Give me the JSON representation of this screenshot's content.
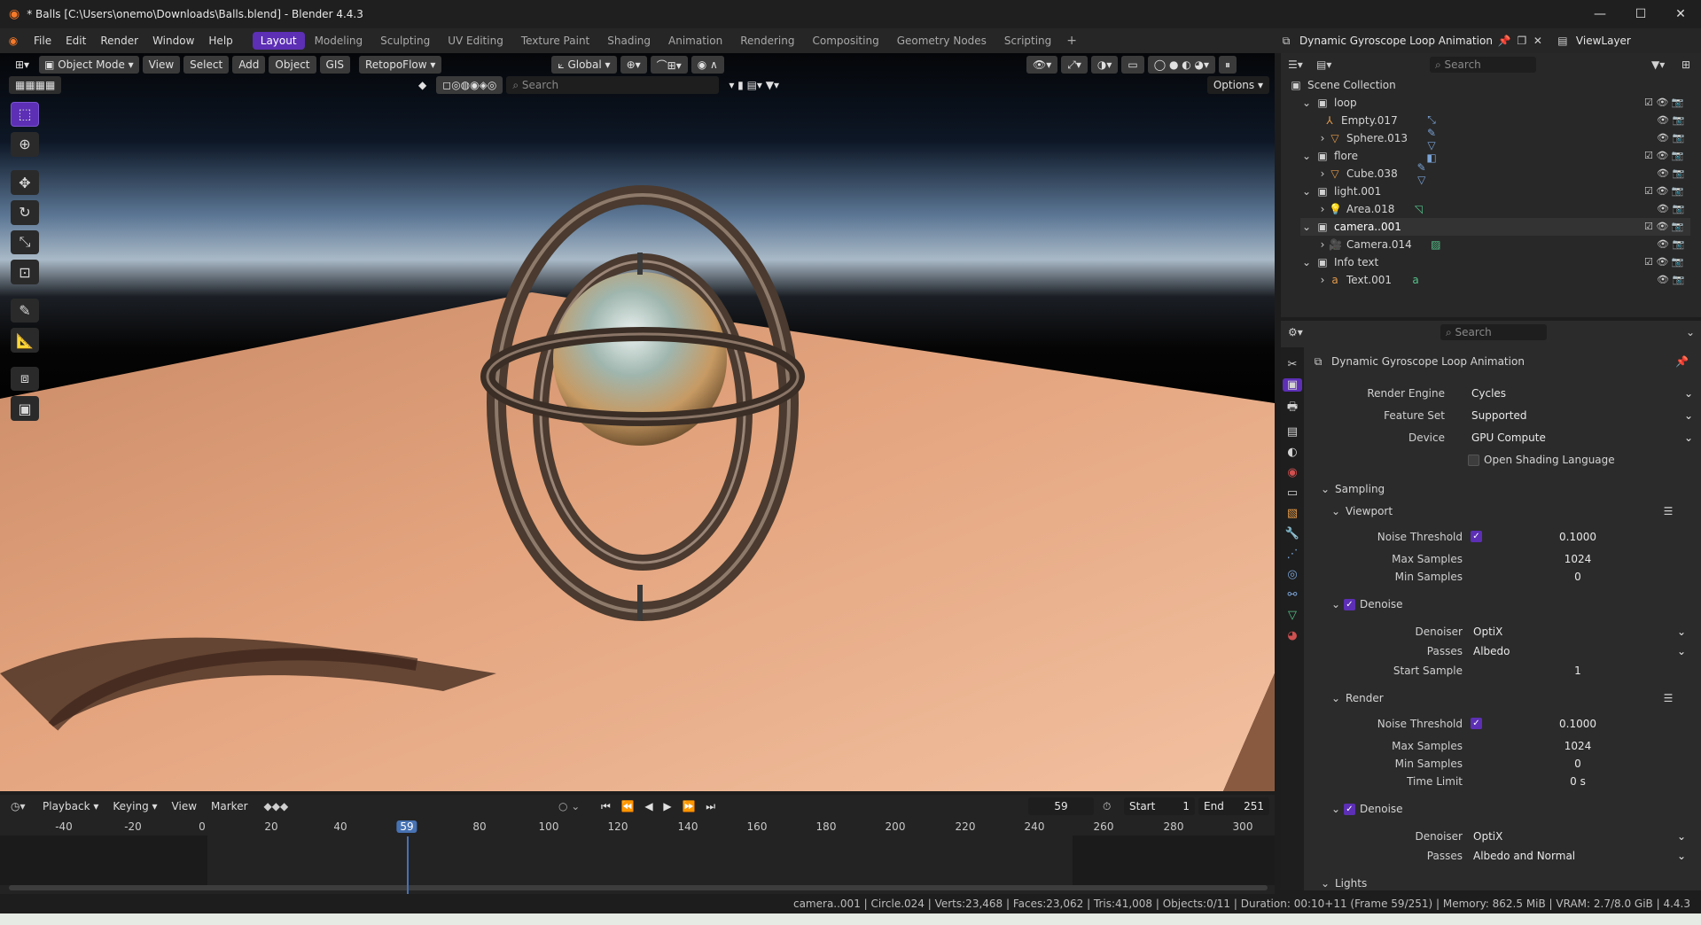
{
  "window": {
    "title": "* Balls [C:\\Users\\onemo\\Downloads\\Balls.blend] - Blender 4.4.3",
    "minimize": "—",
    "maximize": "☐",
    "close": "✕"
  },
  "menu": [
    "File",
    "Edit",
    "Render",
    "Window",
    "Help"
  ],
  "workspaces": [
    "Layout",
    "Modeling",
    "Sculpting",
    "UV Editing",
    "Texture Paint",
    "Shading",
    "Animation",
    "Rendering",
    "Compositing",
    "Geometry Nodes",
    "Scripting"
  ],
  "active_workspace": "Layout",
  "scene_name": "Dynamic Gyroscope Loop Animation",
  "view_layer": "ViewLayer",
  "viewport": {
    "mode": "Object Mode",
    "menus": [
      "View",
      "Select",
      "Add",
      "Object",
      "GIS"
    ],
    "addon": "RetopoFlow",
    "orientation": "Global",
    "search_placeholder": "Search",
    "options": "Options"
  },
  "outliner": {
    "search_placeholder": "Search",
    "root": "Scene Collection",
    "items": [
      {
        "name": "loop",
        "type": "collection"
      },
      {
        "name": "Empty.017",
        "type": "empty"
      },
      {
        "name": "Sphere.013",
        "type": "mesh"
      },
      {
        "name": "flore",
        "type": "collection"
      },
      {
        "name": "Cube.038",
        "type": "mesh"
      },
      {
        "name": "light.001",
        "type": "collection"
      },
      {
        "name": "Area.018",
        "type": "light"
      },
      {
        "name": "camera..001",
        "type": "collection"
      },
      {
        "name": "Camera.014",
        "type": "camera"
      },
      {
        "name": "Info text",
        "type": "collection"
      },
      {
        "name": "Text.001",
        "type": "text"
      }
    ]
  },
  "properties": {
    "search_placeholder": "Search",
    "context": "Dynamic Gyroscope Loop Animation",
    "render_engine_label": "Render Engine",
    "render_engine": "Cycles",
    "feature_set_label": "Feature Set",
    "feature_set": "Supported",
    "device_label": "Device",
    "device": "GPU Compute",
    "osl_label": "Open Shading Language",
    "sampling": "Sampling",
    "viewport_panel": "Viewport",
    "noise_threshold_label": "Noise Threshold",
    "vp_noise_threshold": "0.1000",
    "max_samples_label": "Max Samples",
    "vp_max_samples": "1024",
    "min_samples_label": "Min Samples",
    "vp_min_samples": "0",
    "denoise": "Denoise",
    "denoiser_label": "Denoiser",
    "vp_denoiser": "OptiX",
    "passes_label": "Passes",
    "vp_passes": "Albedo",
    "start_sample_label": "Start Sample",
    "vp_start_sample": "1",
    "render_panel": "Render",
    "r_noise_threshold": "0.1000",
    "r_max_samples": "1024",
    "r_min_samples": "0",
    "time_limit_label": "Time Limit",
    "r_time_limit": "0 s",
    "r_denoiser": "OptiX",
    "r_passes": "Albedo and Normal",
    "lights": "Lights"
  },
  "timeline": {
    "menus": [
      "Playback",
      "Keying",
      "View",
      "Marker"
    ],
    "current_frame": "59",
    "start_label": "Start",
    "start": "1",
    "end_label": "End",
    "end": "251",
    "ticks": [
      "-40",
      "-20",
      "0",
      "20",
      "40",
      "59",
      "80",
      "100",
      "120",
      "140",
      "160",
      "180",
      "200",
      "220",
      "240",
      "260",
      "280",
      "300"
    ]
  },
  "status": "camera..001 | Circle.024 | Verts:23,468 | Faces:23,062 | Tris:41,008 | Objects:0/11 | Duration: 00:10+11 (Frame 59/251) | Memory: 862.5 MiB | VRAM: 2.7/8.0 GiB | 4.4.3",
  "colors": {
    "accent": "#5c2fb5",
    "panel": "#2b2b2b",
    "outliner": "#282828"
  }
}
